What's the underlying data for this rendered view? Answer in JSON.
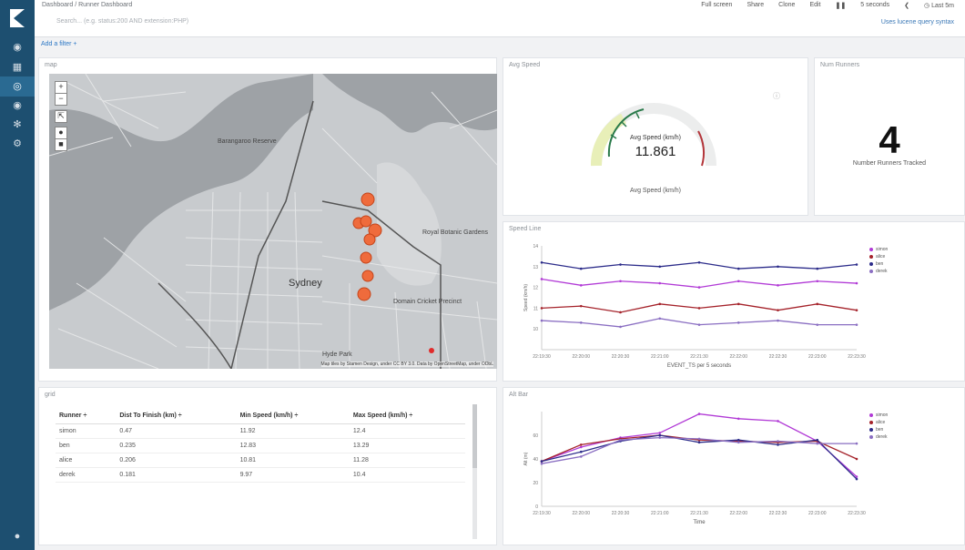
{
  "breadcrumb": {
    "root": "Dashboard",
    "current": "Runner Dashboard"
  },
  "search": {
    "placeholder": "Search... (e.g. status:200 AND extension:PHP)"
  },
  "topmenu": {
    "full_screen": "Full screen",
    "share": "Share",
    "clone": "Clone",
    "edit": "Edit",
    "interval": "5 seconds",
    "time": "Last 5m"
  },
  "lucene_hint": "Uses lucene query syntax",
  "add_filter": "Add a filter +",
  "sidebar": {
    "icons": [
      "discover-icon",
      "visualize-icon",
      "dashboard-icon",
      "timelion-icon",
      "devtools-icon",
      "settings-icon"
    ]
  },
  "panels": {
    "map": {
      "title": "map",
      "attribution": "Map tiles by Stamen Design, under CC BY 3.0. Data by OpenStreetMap, under ODbL",
      "labels": {
        "sydney": "Sydney",
        "barangaroo": "Barangaroo Reserve",
        "botanic": "Royal Botanic Gardens",
        "domain": "Domain Cricket Precinct",
        "hyde": "Hyde Park"
      }
    },
    "avg_speed": {
      "title": "Avg Speed",
      "gauge_label": "Avg Speed (km/h)",
      "value": "11.861",
      "footer": "Avg Speed (km/h)"
    },
    "num_runners": {
      "title": "Num Runners",
      "value": "4",
      "label": "Number Runners Tracked"
    },
    "speed_line": {
      "title": "Speed Line",
      "ylabel": "Speed (km/h)",
      "xlabel": "EVENT_TS per 5 seconds"
    },
    "grid": {
      "title": "grid",
      "columns": [
        "Runner ÷",
        "Dist To Finish (km) ÷",
        "Min Speed (km/h) ÷",
        "Max Speed (km/h) ÷"
      ],
      "rows": [
        [
          "simon",
          "0.47",
          "11.92",
          "12.4"
        ],
        [
          "ben",
          "0.235",
          "12.83",
          "13.29"
        ],
        [
          "alice",
          "0.206",
          "10.81",
          "11.28"
        ],
        [
          "derek",
          "0.181",
          "9.97",
          "10.4"
        ]
      ]
    },
    "alt_bar": {
      "title": "Alt Bar",
      "ylabel": "Alt (m)",
      "xlabel": "Time"
    }
  },
  "legend": [
    {
      "name": "simon",
      "color": "#b13ad6"
    },
    {
      "name": "alice",
      "color": "#a5232b"
    },
    {
      "name": "ben",
      "color": "#2c2c8a"
    },
    {
      "name": "derek",
      "color": "#8a6ec2"
    }
  ],
  "chart_data": [
    {
      "type": "line",
      "title": "Speed Line",
      "ylabel": "Speed (km/h)",
      "xlabel": "EVENT_TS per 5 seconds",
      "ylim": [
        9,
        14
      ],
      "x": [
        "22:19:30",
        "22:20:00",
        "22:20:30",
        "22:21:00",
        "22:21:30",
        "22:22:00",
        "22:22:30",
        "22:23:00",
        "22:23:30"
      ],
      "series": [
        {
          "name": "simon",
          "values": [
            12.4,
            12.1,
            12.3,
            12.2,
            12.0,
            12.3,
            12.1,
            12.3,
            12.2
          ]
        },
        {
          "name": "alice",
          "values": [
            11.0,
            11.1,
            10.8,
            11.2,
            11.0,
            11.2,
            10.9,
            11.2,
            10.9
          ]
        },
        {
          "name": "ben",
          "values": [
            13.2,
            12.9,
            13.1,
            13.0,
            13.2,
            12.9,
            13.0,
            12.9,
            13.1
          ]
        },
        {
          "name": "derek",
          "values": [
            10.4,
            10.3,
            10.1,
            10.5,
            10.2,
            10.3,
            10.4,
            10.2,
            10.2
          ]
        }
      ],
      "legend_position": "right"
    },
    {
      "type": "line",
      "title": "Alt Bar",
      "ylabel": "Alt (m)",
      "xlabel": "Time",
      "ylim": [
        0,
        80
      ],
      "x": [
        "22:19:30",
        "22:20:00",
        "22:20:30",
        "22:21:00",
        "22:21:30",
        "22:22:00",
        "22:22:30",
        "22:23:00",
        "22:23:30"
      ],
      "yticks": [
        0,
        20,
        40,
        60
      ],
      "series": [
        {
          "name": "simon",
          "values": [
            38,
            50,
            58,
            62,
            78,
            74,
            72,
            55,
            25
          ]
        },
        {
          "name": "alice",
          "values": [
            38,
            52,
            57,
            60,
            56,
            55,
            54,
            55,
            40
          ]
        },
        {
          "name": "ben",
          "values": [
            38,
            46,
            55,
            60,
            54,
            56,
            52,
            56,
            23
          ]
        },
        {
          "name": "derek",
          "values": [
            36,
            42,
            56,
            58,
            57,
            54,
            55,
            53,
            53
          ]
        }
      ],
      "legend_position": "right"
    }
  ]
}
